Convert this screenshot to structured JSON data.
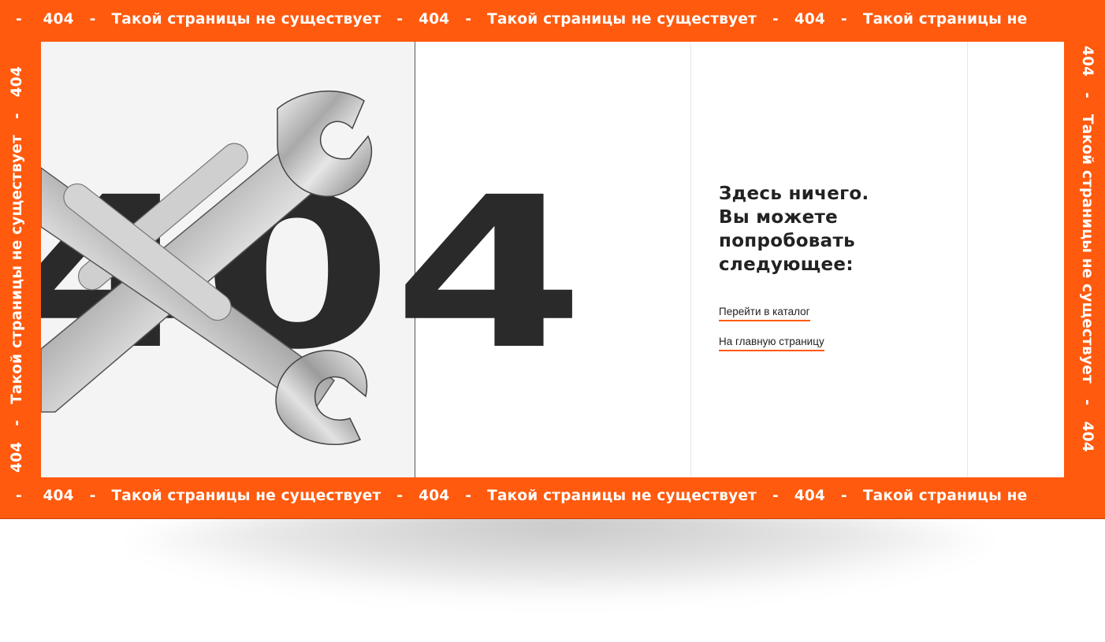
{
  "ticker": {
    "separator": "-",
    "code": "404",
    "message": "Такой страницы не существует",
    "top_tail": "Такой страницы не"
  },
  "error": {
    "code_digit_1": "4",
    "code_digit_2": "0",
    "code_digit_3": "4"
  },
  "content": {
    "headline_lines": [
      "Здесь ничего.",
      "Вы можете",
      "попробовать",
      "следующее:"
    ],
    "links": [
      {
        "label": "Перейти в каталог"
      },
      {
        "label": "На главную страницу"
      }
    ]
  },
  "colors": {
    "accent": "#FF5A0E",
    "text": "#222222",
    "panel": "#f4f4f4"
  },
  "icons": {
    "hero_image": "crossed-wrenches"
  }
}
